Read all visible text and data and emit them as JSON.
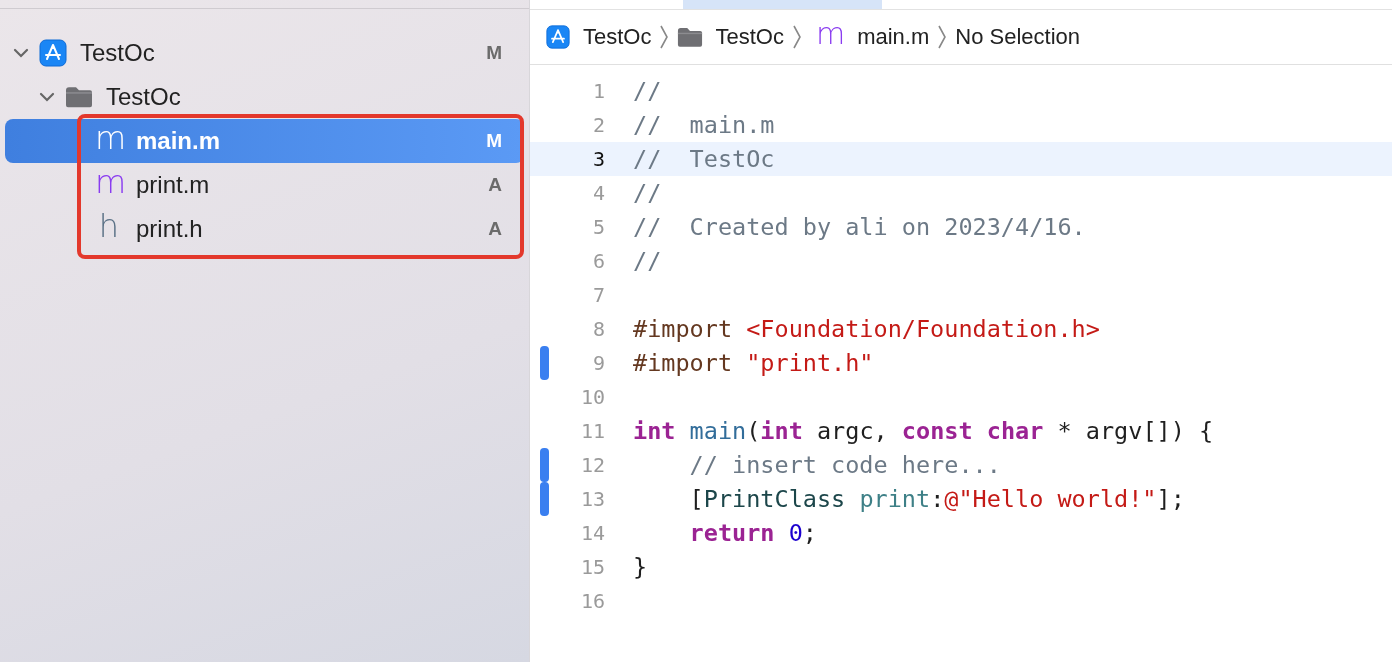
{
  "navigator": {
    "project": {
      "name": "TestOc",
      "status": "M",
      "expanded": true,
      "children": [
        {
          "name": "TestOc",
          "kind": "folder",
          "expanded": true,
          "children": [
            {
              "name": "main.m",
              "glyph": "m",
              "kind": "implementation",
              "status": "M",
              "selected": true
            },
            {
              "name": "print.m",
              "glyph": "m",
              "kind": "implementation",
              "status": "A",
              "selected": false
            },
            {
              "name": "print.h",
              "glyph": "h",
              "kind": "header",
              "status": "A",
              "selected": false
            }
          ]
        }
      ]
    }
  },
  "annotation": {
    "kind": "rectangle",
    "color": "#e3382c"
  },
  "breadcrumb": [
    {
      "kind": "project",
      "label": "TestOc"
    },
    {
      "kind": "folder",
      "label": "TestOc"
    },
    {
      "kind": "file",
      "glyph": "m",
      "label": "main.m"
    },
    {
      "kind": "symbol",
      "label": "No Selection"
    }
  ],
  "code": [
    {
      "number": "1",
      "changed": false,
      "current": false,
      "tokens": [
        {
          "kind": "comment",
          "text": "//"
        }
      ]
    },
    {
      "number": "2",
      "changed": false,
      "current": false,
      "tokens": [
        {
          "kind": "comment",
          "text": "//  main.m"
        }
      ]
    },
    {
      "number": "3",
      "changed": false,
      "current": true,
      "tokens": [
        {
          "kind": "comment",
          "text": "//  TestOc"
        }
      ]
    },
    {
      "number": "4",
      "changed": false,
      "current": false,
      "tokens": [
        {
          "kind": "comment",
          "text": "//"
        }
      ]
    },
    {
      "number": "5",
      "changed": false,
      "current": false,
      "tokens": [
        {
          "kind": "comment",
          "text": "//  Created by ali on 2023/4/16."
        }
      ]
    },
    {
      "number": "6",
      "changed": false,
      "current": false,
      "tokens": [
        {
          "kind": "comment",
          "text": "//"
        }
      ]
    },
    {
      "number": "7",
      "changed": false,
      "current": false
    },
    {
      "number": "8",
      "changed": false,
      "current": false,
      "tokens": [
        {
          "kind": "preproc",
          "text": "#import "
        },
        {
          "kind": "string",
          "text": "<Foundation/Foundation.h>"
        }
      ]
    },
    {
      "number": "9",
      "changed": true,
      "current": false,
      "tokens": [
        {
          "kind": "preproc",
          "text": "#import "
        },
        {
          "kind": "string",
          "text": "\"print.h\""
        }
      ]
    },
    {
      "number": "10",
      "changed": false,
      "current": false
    },
    {
      "number": "11",
      "changed": false,
      "current": false,
      "tokens": [
        {
          "kind": "keyword",
          "text": "int"
        },
        {
          "kind": "function",
          "text": " main"
        },
        {
          "kind": "plain",
          "text": "("
        },
        {
          "kind": "keyword",
          "text": "int"
        },
        {
          "kind": "plain",
          "text": " argc, "
        },
        {
          "kind": "keyword",
          "text": "const"
        },
        {
          "kind": "keyword",
          "text": " char"
        },
        {
          "kind": "plain",
          "text": " * argv[]) {"
        }
      ]
    },
    {
      "number": "12",
      "changed": true,
      "current": false,
      "tokens": [
        {
          "kind": "comment",
          "text": "    // insert code here..."
        }
      ]
    },
    {
      "number": "13",
      "changed": true,
      "current": false,
      "tokens": [
        {
          "kind": "plain",
          "text": "    ["
        },
        {
          "kind": "type",
          "text": "PrintClass"
        },
        {
          "kind": "method",
          "text": " print"
        },
        {
          "kind": "plain",
          "text": ":"
        },
        {
          "kind": "string",
          "text": "@\"Hello world!\""
        },
        {
          "kind": "plain",
          "text": "];"
        }
      ]
    },
    {
      "number": "14",
      "changed": false,
      "current": false,
      "tokens": [
        {
          "kind": "keyword",
          "text": "    return"
        },
        {
          "kind": "number",
          "text": " 0"
        },
        {
          "kind": "plain",
          "text": ";"
        }
      ]
    },
    {
      "number": "15",
      "changed": false,
      "current": false,
      "tokens": [
        {
          "kind": "plain",
          "text": "}"
        }
      ]
    },
    {
      "number": "16",
      "changed": false,
      "current": false
    }
  ]
}
